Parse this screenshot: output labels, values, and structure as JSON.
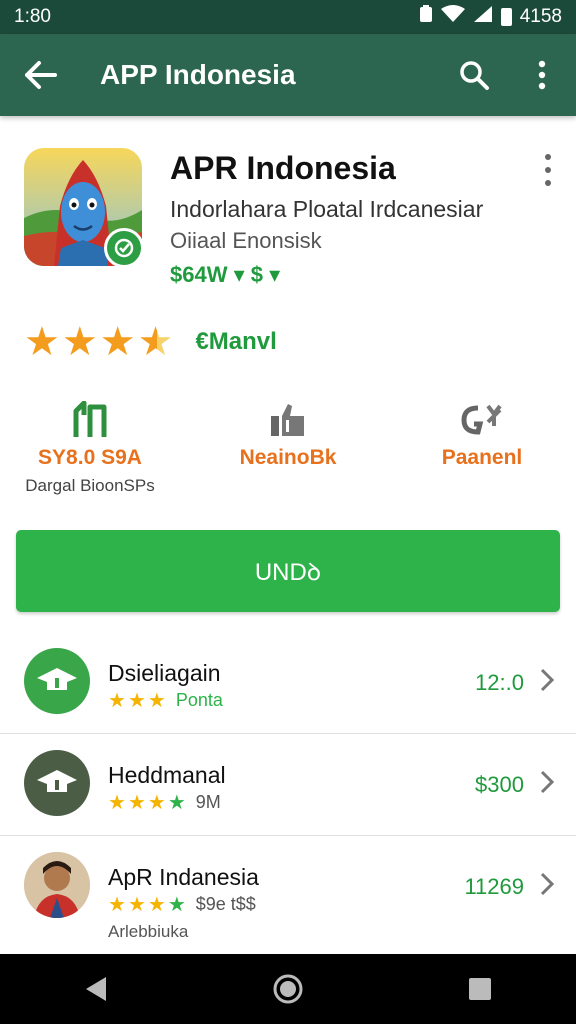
{
  "status_bar": {
    "time": "1:80",
    "battery_text": "4158"
  },
  "app_bar": {
    "title": "APP Indonesia"
  },
  "app": {
    "name": "APR Indonesia",
    "developer": "Indorlahara Ploatal Irdcanesiar",
    "subtitle": "Oiiaal Enonsisk",
    "price": "$64W ▾ $ ▾"
  },
  "rating": {
    "label": "€Manvl",
    "value": 3.5,
    "max": 5
  },
  "stats": [
    {
      "value": "SY8.0 S9A",
      "caption": "Dargal BioonSPs"
    },
    {
      "value": "NeainoBk",
      "caption": ""
    },
    {
      "value": "Paanenl",
      "caption": ""
    }
  ],
  "install_button": {
    "label": "UNDꝺ"
  },
  "related": [
    {
      "title": "Dsieliagain",
      "meta": "Ponta",
      "price": "12:.0",
      "stars": 3,
      "green_stars": 0,
      "extra": ""
    },
    {
      "title": "Heddmanal",
      "meta": "9M",
      "price": "$300",
      "stars": 3,
      "green_stars": 1,
      "extra": ""
    },
    {
      "title": "ApR Indanesia",
      "meta": "$9e t$$",
      "price": "11269",
      "stars": 3,
      "green_stars": 1,
      "extra": "Arlebbiuka"
    }
  ],
  "colors": {
    "status_bar": "#1c4a3a",
    "app_bar": "#2d6650",
    "accent_green": "#2eb34a",
    "stat_orange": "#e8711d"
  },
  "icons": [
    "back-arrow-icon",
    "search-icon",
    "overflow-menu-icon",
    "verified-badge-icon",
    "downloads-icon",
    "thumbs-icon",
    "gesture-icon",
    "chevron-right-icon",
    "nav-back-icon",
    "nav-home-icon",
    "nav-recents-icon"
  ]
}
